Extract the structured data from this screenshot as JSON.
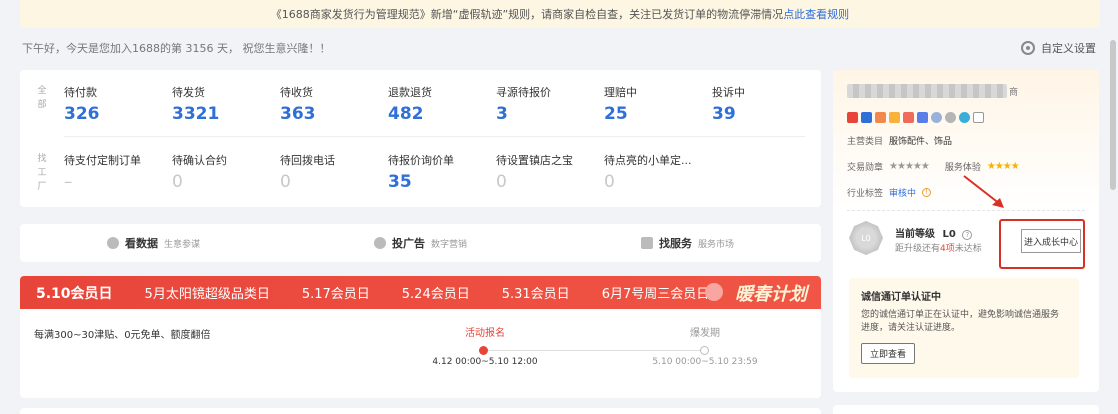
{
  "notice": {
    "text": "《1688商家发货行为管理规范》新增“虚假轨迹”规则，请商家自检自查，关注已发货订单的物流停滞情况",
    "link": "点此查看规则"
  },
  "greeting": "下午好，今天是您加入1688的第 3156 天， 祝您生意兴隆！！",
  "customize_label": "自定义设置",
  "stats": {
    "row1_label": "全部",
    "row1": [
      {
        "label": "待付款",
        "value": "326"
      },
      {
        "label": "待发货",
        "value": "3321"
      },
      {
        "label": "待收货",
        "value": "363"
      },
      {
        "label": "退款退货",
        "value": "482"
      },
      {
        "label": "寻源待报价",
        "value": "3"
      },
      {
        "label": "理赔中",
        "value": "25"
      },
      {
        "label": "投诉中",
        "value": "39"
      }
    ],
    "row2_label": "找工厂",
    "row2": [
      {
        "label": "待支付定制订单",
        "value": "–"
      },
      {
        "label": "待确认合约",
        "value": "0"
      },
      {
        "label": "待回拨电话",
        "value": "0"
      },
      {
        "label": "待报价询价单",
        "value": "35"
      },
      {
        "label": "待设置镇店之宝",
        "value": "0"
      },
      {
        "label": "待点亮的小单定...",
        "value": "0"
      }
    ]
  },
  "tools": [
    {
      "title": "看数据",
      "sub": "生意参谋"
    },
    {
      "title": "投广告",
      "sub": "数字营销"
    },
    {
      "title": "找服务",
      "sub": "服务市场"
    }
  ],
  "promo": {
    "tabs": [
      "5.10会员日",
      "5月太阳镜超级品类日",
      "5.17会员日",
      "5.24会员日",
      "5.31会员日",
      "6月7号周三会员日"
    ],
    "logo": "暖春计划",
    "desc": "每满300~30津贴、0元免单、额度翻倍",
    "phase1": {
      "name": "活动报名",
      "date": "4.12 00:00~5.10 12:00"
    },
    "phase2": {
      "name": "爆发期",
      "date": "5.10 00:00~5.10 23:59"
    }
  },
  "side": {
    "name_suffix": "商",
    "main_category_label": "主营类目",
    "main_category": "服饰配件、饰品",
    "trade_medal_label": "交易勋章",
    "trade_medal_stars": "★★★★★",
    "service_label": "服务体验",
    "service_stars": "★★★★",
    "industry_label": "行业标签",
    "industry_status": "审核中",
    "level_title": "当前等级",
    "level_value": "L0",
    "medal_text": "L0",
    "level_sub_pre": "距升级还有",
    "level_sub_count": "4项",
    "level_sub_post": "未达标",
    "grow_button": "进入成长中心",
    "cert_title": "诚信通订单认证中",
    "cert_desc": "您的诚信通订单正在认证中，避免影响诚信通服务进度，请关注认证进度。",
    "cert_button": "立即查看"
  },
  "colors": {
    "accent_blue": "#2f6fd8",
    "promo_red": "#e8453a",
    "highlight_red": "#d93025"
  }
}
